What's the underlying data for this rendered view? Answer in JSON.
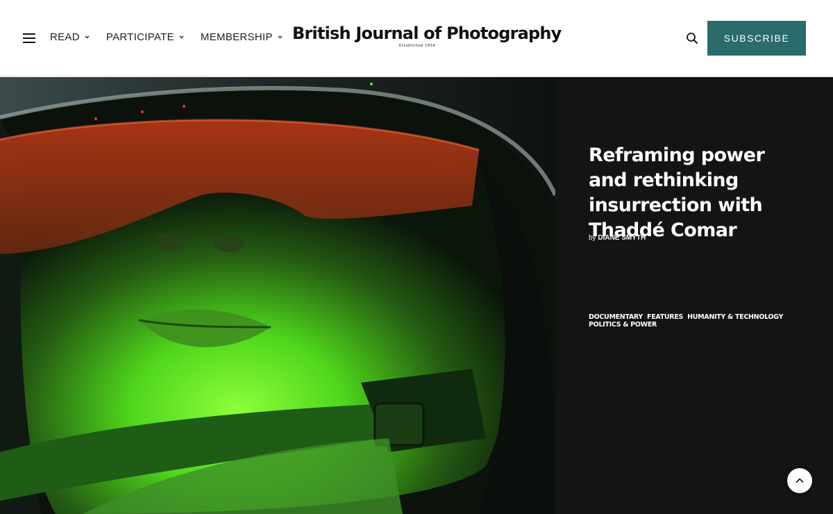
{
  "header": {
    "nav": [
      {
        "label": "READ"
      },
      {
        "label": "PARTICIPATE"
      },
      {
        "label": "MEMBERSHIP"
      }
    ],
    "logo": {
      "title": "British Journal of Photography",
      "subtitle": "Established 1854"
    },
    "subscribe_label": "SUBSCRIBE"
  },
  "hero": {
    "title": "Reframing power and rethinking insurrection with Thaddé Comar",
    "byline_prefix": "by",
    "author": "DIANE SMYTH",
    "tags": [
      "DOCUMENTARY",
      "FEATURES",
      "HUMANITY & TECHNOLOGY",
      "POLITICS & POWER"
    ],
    "image_icon": "photo-portrait"
  },
  "colors": {
    "accent": "#2a6b6b",
    "panel_bg": "#141414",
    "header_bg": "#ffffff"
  },
  "icons": {
    "menu": "hamburger-icon",
    "search": "search-icon",
    "chevron": "chevron-down-icon",
    "scroll_top": "chevron-up-icon"
  }
}
